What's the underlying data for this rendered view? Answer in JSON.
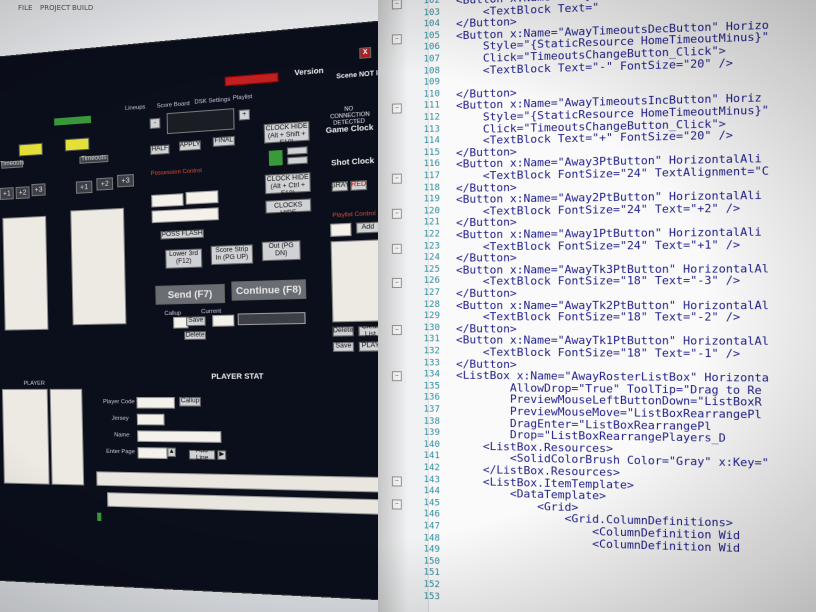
{
  "scoreboard_app": {
    "menu": [
      "FILE",
      "PROJECT",
      "BUILD"
    ],
    "status_red": "",
    "version": "Version",
    "scene_status": "Scene NOT loaded",
    "close_x": "X",
    "tabs": [
      "Lineups",
      "Score Board",
      "DSK Settings",
      "Playlist"
    ],
    "minus": "-",
    "plus": "+",
    "score_buttons": [
      "+1",
      "+2",
      "+3"
    ],
    "half_button": "HALF",
    "apply_button": "APPLY",
    "final_button": "FINAL",
    "game_clock_hide": "GAME CLOCK HIDE (Alt + Shift + F10)",
    "shot_clock_hide": "SHOT CLOCK HIDE (Alt + Ctrl + F10)",
    "both_clocks_hide": "BOTH CLOCKS HIDE",
    "no_connection": "NO CONNECTION DETECTED",
    "game_clock": "Game Clock",
    "shot_clock": "Shot Clock",
    "gray_button": "GRAY",
    "red_button": "RED",
    "possession_label": "Possession Control",
    "pos_flash": "POSS FLASH",
    "lower_3rd": "Lower 3rd (F12)",
    "score_strip_in": "Score Strip In (PG UP)",
    "out_button": "Out (PG DN)",
    "send_button": "Send (F7)",
    "continue_button": "Continue (F8)",
    "callup_label": "Callup",
    "current_label": "Current",
    "save_small": "Save",
    "delete_small": "Delete",
    "playlist_control": "Playlist Control",
    "add_button": "Add",
    "delete_button": "Delete",
    "clear_list": "Clear List",
    "save_button": "Save",
    "play_button": "PLAY",
    "player_stat": "PLAYER STAT",
    "player_code": "Player Code",
    "jersey": "Jersey",
    "name": "Name",
    "enter_page": "Enter Page",
    "callup_btn": "Callup",
    "add_button_small": "Add Line",
    "timeouts": "Timeouts",
    "player_col": "PLAYER"
  },
  "editor": {
    "line_numbers": [
      "102",
      "103",
      "104",
      "105",
      "106",
      "107",
      "108",
      "109",
      "110",
      "111",
      "112",
      "113",
      "114",
      "115",
      "116",
      "117",
      "118",
      "119",
      "120",
      "121",
      "122",
      "123",
      "124",
      "125",
      "126",
      "127",
      "128",
      "129",
      "130",
      "131",
      "132",
      "133",
      "134",
      "135",
      "136",
      "137",
      "138",
      "139",
      "140",
      "141",
      "142",
      "143",
      "144",
      "145",
      "146",
      "147",
      "148",
      "149",
      "150",
      "151",
      "152",
      "153"
    ],
    "lines": [
      "<Button x:Name=\"AwayTimeoutsDecButton\" Horiz",
      "    <TextBlock Text=\"",
      "</Button>",
      "<Button x:Name=\"AwayTimeoutsDecButton\" Horizo",
      "    Style=\"{StaticResource HomeTimeoutMinus}\"",
      "    Click=\"TimeoutsChangeButton_Click\">",
      "    <TextBlock Text=\"-\" FontSize=\"20\" />",
      "",
      "</Button>",
      "<Button x:Name=\"AwayTimeoutsIncButton\" Horiz",
      "    Style=\"{StaticResource HomeTimeoutMinus}\"",
      "    Click=\"TimeoutsChangeButton_Click\">",
      "    <TextBlock Text=\"+\" FontSize=\"20\" />",
      "</Button>",
      "<Button x:Name=\"Away3PtButton\" HorizontalAli",
      "    <TextBlock FontSize=\"24\" TextAlignment=\"C",
      "</Button>",
      "<Button x:Name=\"Away2PtButton\" HorizontalAli",
      "    <TextBlock FontSize=\"24\" Text=\"+2\" />",
      "</Button>",
      "<Button x:Name=\"Away1PtButton\" HorizontalAli",
      "    <TextBlock FontSize=\"24\" Text=\"+1\" />",
      "</Button>",
      "<Button x:Name=\"AwayTk3PtButton\" HorizontalAl",
      "    <TextBlock FontSize=\"18\" Text=\"-3\" />",
      "</Button>",
      "<Button x:Name=\"AwayTk2PtButton\" HorizontalAl",
      "    <TextBlock FontSize=\"18\" Text=\"-2\" />",
      "</Button>",
      "<Button x:Name=\"AwayTk1PtButton\" HorizontalAl",
      "    <TextBlock FontSize=\"18\" Text=\"-1\" />",
      "</Button>",
      "<ListBox x:Name=\"AwayRosterListBox\" Horizonta",
      "        AllowDrop=\"True\" ToolTip=\"Drag to Re",
      "        PreviewMouseLeftButtonDown=\"ListBoxR",
      "        PreviewMouseMove=\"ListBoxRearrangePl",
      "        DragEnter=\"ListBoxRearrangePl",
      "        Drop=\"ListBoxRearrangePlayers_D",
      "    <ListBox.Resources>",
      "        <SolidColorBrush Color=\"Gray\" x:Key=\"",
      "    </ListBox.Resources>",
      "    <ListBox.ItemTemplate>",
      "        <DataTemplate>",
      "            <Grid>",
      "                <Grid.ColumnDefinitions>",
      "                    <ColumnDefinition Wid",
      "                    <ColumnDefinition Wid"
    ]
  }
}
